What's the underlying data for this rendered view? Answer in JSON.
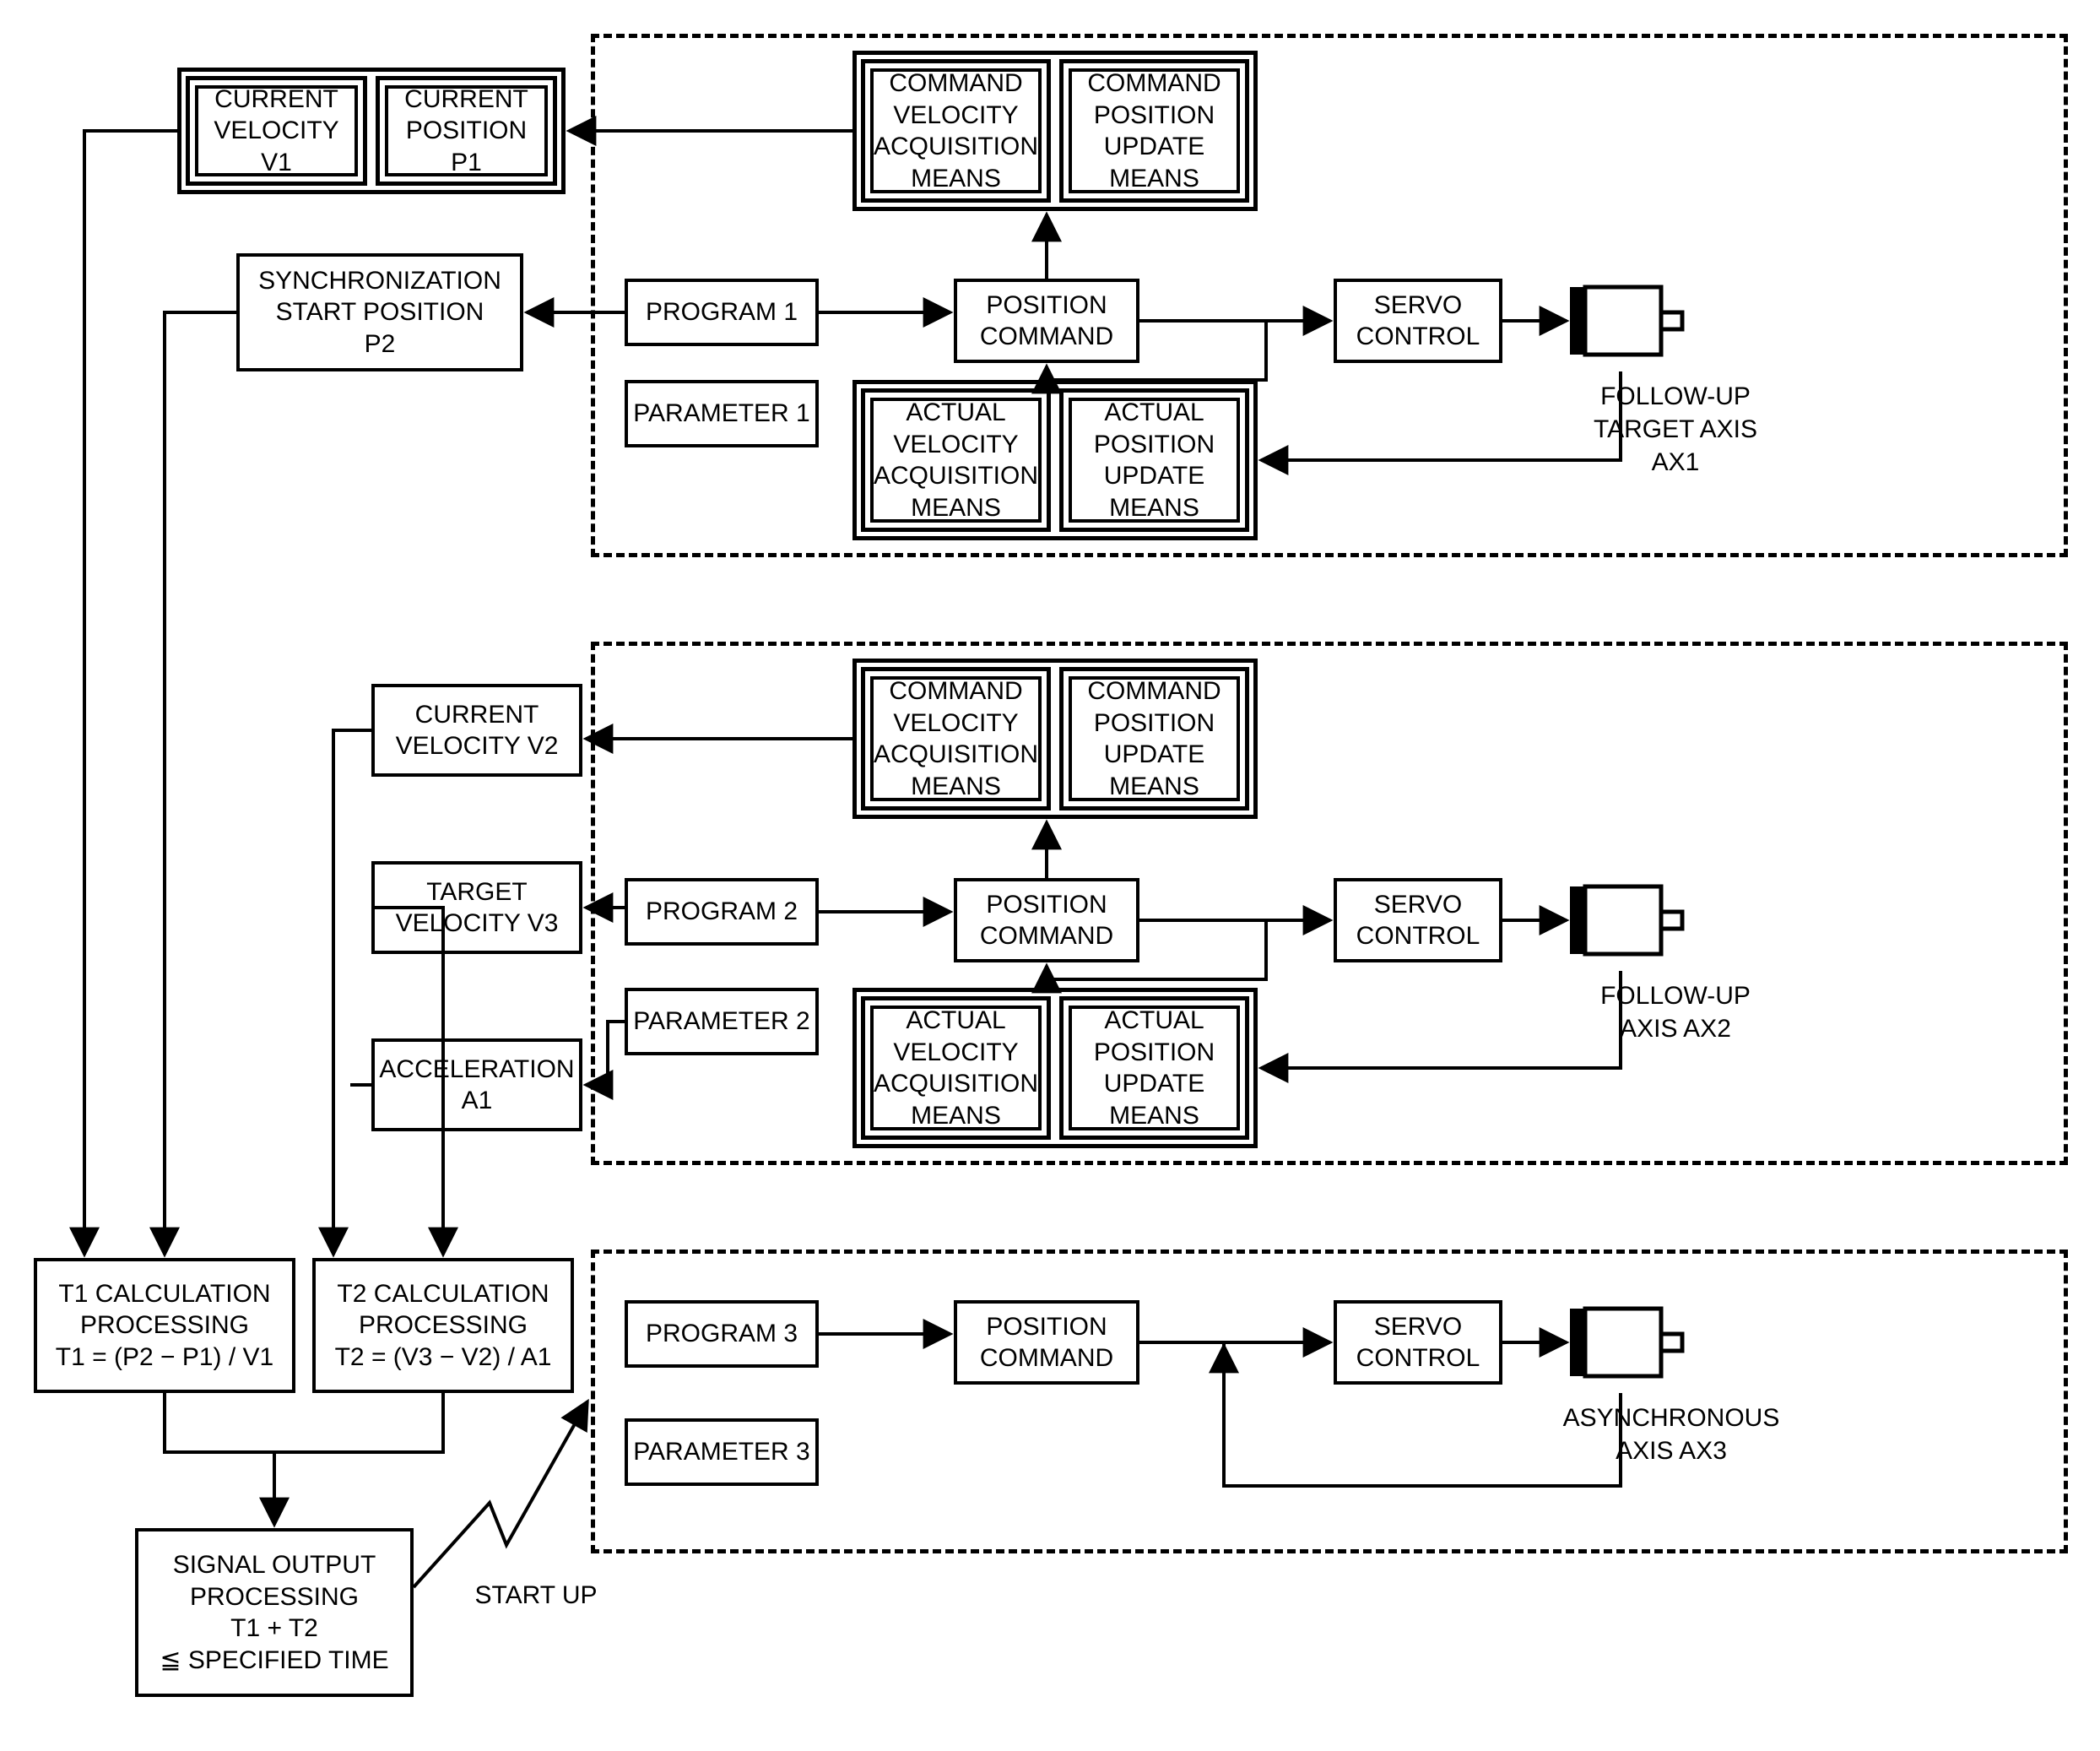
{
  "group1": {
    "cur_vel_v1": "CURRENT\nVELOCITY V1",
    "cur_pos_p1": "CURRENT\nPOSITION P1",
    "sync_start_p2": "SYNCHRONIZATION\nSTART POSITION\nP2",
    "program1": "PROGRAM 1",
    "parameter1": "PARAMETER 1",
    "pos_cmd1": "POSITION\nCOMMAND",
    "servo1": "SERVO\nCONTROL",
    "cmd_vel_acq1": "COMMAND\nVELOCITY\nACQUISITION\nMEANS",
    "cmd_pos_upd1": "COMMAND\nPOSITION\nUPDATE\nMEANS",
    "act_vel_acq1": "ACTUAL\nVELOCITY\nACQUISITION\nMEANS",
    "act_pos_upd1": "ACTUAL\nPOSITION\nUPDATE\nMEANS",
    "axis1_label": "FOLLOW-UP\nTARGET AXIS\nAX1"
  },
  "group2": {
    "cur_vel_v2": "CURRENT\nVELOCITY V2",
    "target_vel_v3": "TARGET\nVELOCITY V3",
    "accel_a1": "ACCELERATION\nA1",
    "program2": "PROGRAM 2",
    "parameter2": "PARAMETER 2",
    "pos_cmd2": "POSITION\nCOMMAND",
    "servo2": "SERVO\nCONTROL",
    "cmd_vel_acq2": "COMMAND\nVELOCITY\nACQUISITION\nMEANS",
    "cmd_pos_upd2": "COMMAND\nPOSITION\nUPDATE\nMEANS",
    "act_vel_acq2": "ACTUAL\nVELOCITY\nACQUISITION\nMEANS",
    "act_pos_upd2": "ACTUAL\nPOSITION\nUPDATE\nMEANS",
    "axis2_label": "FOLLOW-UP\nAXIS AX2"
  },
  "group3": {
    "program3": "PROGRAM 3",
    "parameter3": "PARAMETER 3",
    "pos_cmd3": "POSITION\nCOMMAND",
    "servo3": "SERVO\nCONTROL",
    "axis3_label": "ASYNCHRONOUS\nAXIS AX3"
  },
  "calc": {
    "t1": "T1 CALCULATION\nPROCESSING\nT1 = (P2 − P1) / V1",
    "t2": "T2 CALCULATION\nPROCESSING\nT2 = (V3 − V2) / A1",
    "signal": "SIGNAL OUTPUT\nPROCESSING\nT1 + T2\n≦ SPECIFIED TIME",
    "startup": "START UP"
  }
}
